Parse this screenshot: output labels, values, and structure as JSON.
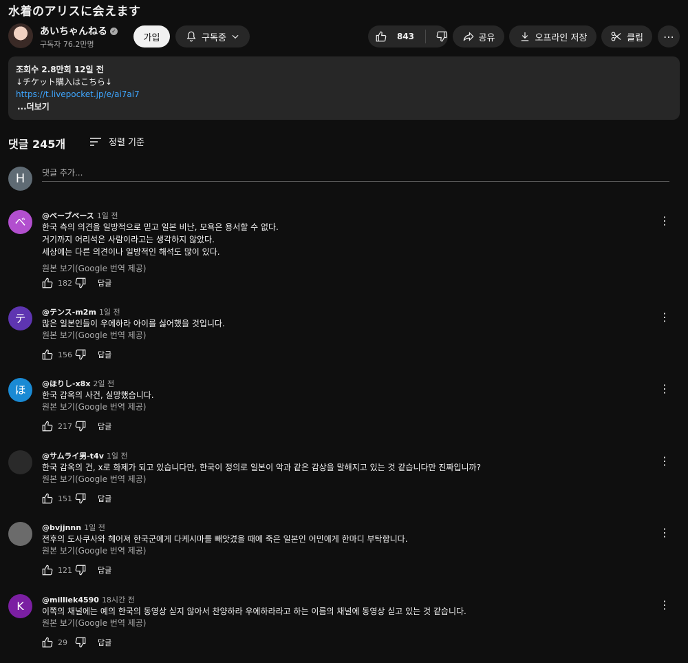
{
  "video_title": "水着のアリスに会えます",
  "channel": {
    "name": "あいちゃんねる",
    "subs": "구독자 76.2만명",
    "join": "가입",
    "subscribed": "구독중"
  },
  "actions": {
    "likes": "843",
    "share": "공유",
    "download": "오프라인 저장",
    "clip": "클립",
    "more": "⋯"
  },
  "description": {
    "meta": "조회수 2.8만회  12일 전",
    "line1": "↓チケット購入はこちら↓",
    "link": "https://t.livepocket.jp/e/ai7ai7",
    "more": "...더보기"
  },
  "comments_header": "댓글 245개",
  "sort_label": "정렬 기준",
  "add_comment": {
    "avatar": "H",
    "placeholder": "댓글 추가..."
  },
  "translate_label": "원본 보기(Google 번역 제공)",
  "reply_label": "답글",
  "comments": [
    {
      "handle": "@ベーブベース",
      "time": "1일 전",
      "avatar": "ベ",
      "avatar_color": "#b24fce",
      "text": "한국 측의 의견을 일방적으로 믿고 일본 비난, 모욕은 용서할 수 없다.\n거기까지 어리석은 사람이라고는 생각하지 않았다.\n세상에는 다른 의견이나 일방적인 해석도 많이 있다.",
      "likes": "182"
    },
    {
      "handle": "@テンス-m2m",
      "time": "1일 전",
      "avatar": "テ",
      "avatar_color": "#5e35b1",
      "text": "많은 일본인들이 우에하라 아이를 싫어했을 것입니다.",
      "likes": "156"
    },
    {
      "handle": "@ほりし-x8x",
      "time": "2일 전",
      "avatar": "ほ",
      "avatar_color": "#1a8ad4",
      "text": "한국 감옥의 사건, 실망했습니다.",
      "likes": "217"
    },
    {
      "handle": "@サムライ男-t4v",
      "time": "1일 전",
      "avatar": "",
      "avatar_color": "#2a2a2a",
      "text": "한국 감옥의 건, x로 화제가 되고 있습니다만, 한국이 정의로 일본이 악과 같은 감상을 말해지고 있는 것 같습니다만 진짜입니까?",
      "likes": "151"
    },
    {
      "handle": "@bvjjnnn",
      "time": "1일 전",
      "avatar": "",
      "avatar_color": "#6b6b6b",
      "text": "전후의 도사쿠사와 헤어져 한국군에게 다케시마를 빼앗겼을 때에 죽은 일본인 어민에게 한마디 부탁합니다.",
      "likes": "121"
    },
    {
      "handle": "@milliek4590",
      "time": "18시간 전",
      "avatar": "K",
      "avatar_color": "#7b1fa2",
      "text": "이쪽의 채널에는 예의 한국의 동영상 싣지 않아서 찬양하라 우에하라라고 하는 이름의 채널에 동영상 싣고 있는 것 같습니다.",
      "likes": "29"
    }
  ]
}
